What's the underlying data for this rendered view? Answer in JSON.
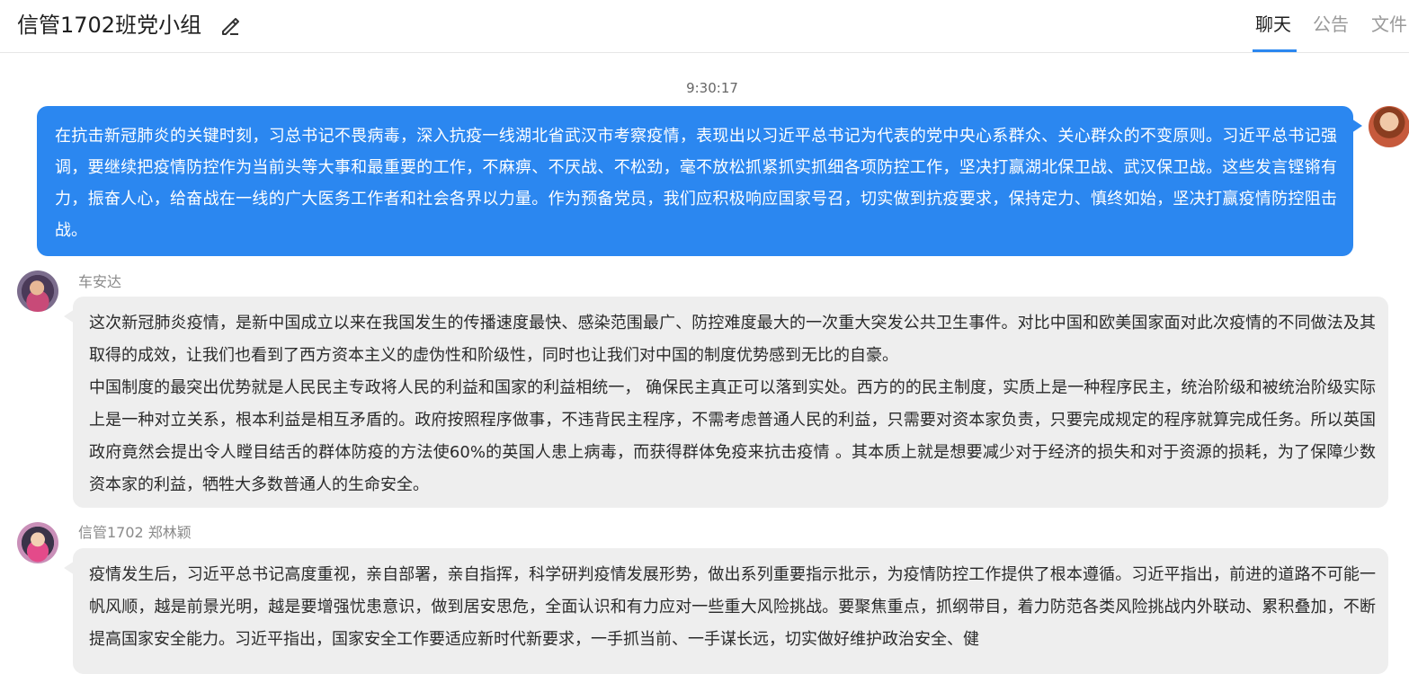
{
  "header": {
    "title": "信管1702班党小组",
    "tabs": [
      {
        "label": "聊天",
        "active": true
      },
      {
        "label": "公告",
        "active": false
      },
      {
        "label": "文件",
        "active": false
      }
    ],
    "accent_color": "#2b87f0"
  },
  "messages": [
    {
      "timestamp": "9:30:17",
      "sender": "",
      "self": true,
      "paragraphs": [
        "在抗击新冠肺炎的关键时刻，习总书记不畏病毒，深入抗疫一线湖北省武汉市考察疫情，表现出以习近平总书记为代表的党中央心系群众、关心群众的不变原则。习近平总书记强调，要继续把疫情防控作为当前头等大事和最重要的工作，不麻痹、不厌战、不松劲，毫不放松抓紧抓实抓细各项防控工作，坚决打赢湖北保卫战、武汉保卫战。这些发言铿锵有力，振奋人心，给奋战在一线的广大医务工作者和社会各界以力量。作为预备党员，我们应积极响应国家号召，切实做到抗疫要求，保持定力、慎终如始，坚决打赢疫情防控阻击战。"
      ]
    },
    {
      "sender": "车安达",
      "self": false,
      "paragraphs": [
        "这次新冠肺炎疫情，是新中国成立以来在我国发生的传播速度最快、感染范围最广、防控难度最大的一次重大突发公共卫生事件。对比中国和欧美国家面对此次疫情的不同做法及其取得的成效，让我们也看到了西方资本主义的虚伪性和阶级性，同时也让我们对中国的制度优势感到无比的自豪。",
        "中国制度的最突出优势就是人民民主专政将人民的利益和国家的利益相统一， 确保民主真正可以落到实处。西方的的民主制度，实质上是一种程序民主，统治阶级和被统治阶级实际上是一种对立关系，根本利益是相互矛盾的。政府按照程序做事，不违背民主程序，不需考虑普通人民的利益，只需要对资本家负责，只要完成规定的程序就算完成任务。所以英国政府竟然会提出令人瞠目结舌的群体防疫的方法使60%的英国人患上病毒，而获得群体免疫来抗击疫情 。其本质上就是想要减少对于经济的损失和对于资源的损耗，为了保障少数资本家的利益，牺牲大多数普通人的生命安全。"
      ]
    },
    {
      "sender": "信管1702 郑林颖",
      "self": false,
      "paragraphs": [
        "疫情发生后，习近平总书记高度重视，亲自部署，亲自指挥，科学研判疫情发展形势，做出系列重要指示批示，为疫情防控工作提供了根本遵循。习近平指出，前进的道路不可能一帆风顺，越是前景光明，越是要增强忧患意识，做到居安思危，全面认识和有力应对一些重大风险挑战。要聚焦重点，抓纲带目，着力防范各类风险挑战内外联动、累积叠加，不断提高国家安全能力。习近平指出，国家安全工作要适应新时代新要求，一手抓当前、一手谋长远，切实做好维护政治安全、健"
      ]
    }
  ]
}
